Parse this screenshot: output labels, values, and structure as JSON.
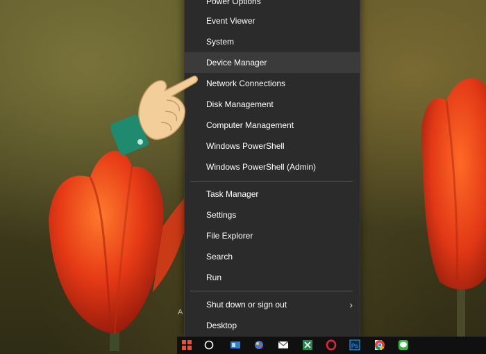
{
  "menu": {
    "items": [
      {
        "id": "power-options",
        "label": "Power Options"
      },
      {
        "id": "event-viewer",
        "label": "Event Viewer"
      },
      {
        "id": "system",
        "label": "System"
      },
      {
        "id": "device-manager",
        "label": "Device Manager"
      },
      {
        "id": "network-connections",
        "label": "Network Connections"
      },
      {
        "id": "disk-management",
        "label": "Disk Management"
      },
      {
        "id": "computer-management",
        "label": "Computer Management"
      },
      {
        "id": "windows-powershell",
        "label": "Windows PowerShell"
      },
      {
        "id": "windows-powershell-admin",
        "label": "Windows PowerShell (Admin)"
      },
      {
        "id": "task-manager",
        "label": "Task Manager"
      },
      {
        "id": "settings",
        "label": "Settings"
      },
      {
        "id": "file-explorer",
        "label": "File Explorer"
      },
      {
        "id": "search",
        "label": "Search"
      },
      {
        "id": "run",
        "label": "Run"
      },
      {
        "id": "shut-down",
        "label": "Shut down or sign out"
      },
      {
        "id": "desktop",
        "label": "Desktop"
      }
    ],
    "highlighted": "Device Manager"
  },
  "taskbar": {
    "icons": [
      "windows-start-icon",
      "cortana-icon",
      "task-view-icon",
      "paint-icon",
      "mail-icon",
      "excel-icon",
      "opera-icon",
      "photoshop-icon",
      "notepad-icon",
      "chrome-icon",
      "line-icon"
    ]
  },
  "colors": {
    "menu_bg": "#2b2b2b",
    "menu_highlight": "#3b3b3b",
    "taskbar_bg": "#101010",
    "tulip": "#e8441c"
  }
}
